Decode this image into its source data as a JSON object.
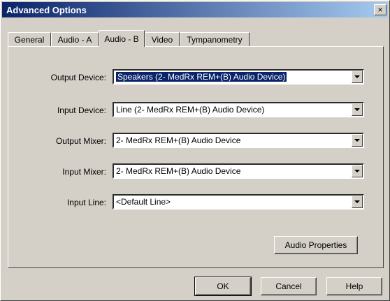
{
  "window": {
    "title": "Advanced Options",
    "close_label": "×"
  },
  "tabs": [
    {
      "label": "General"
    },
    {
      "label": "Audio - A"
    },
    {
      "label": "Audio - B"
    },
    {
      "label": "Video"
    },
    {
      "label": "Tympanometry"
    }
  ],
  "active_tab": "Audio - B",
  "fields": [
    {
      "label": "Output Device:",
      "value": "Speakers (2- MedRx REM+(B) Audio Device)"
    },
    {
      "label": "Input Device:",
      "value": "Line (2- MedRx REM+(B) Audio Device)"
    },
    {
      "label": "Output Mixer:",
      "value": "2- MedRx REM+(B) Audio Device"
    },
    {
      "label": "Input Mixer:",
      "value": "2- MedRx REM+(B) Audio Device"
    },
    {
      "label": "Input Line:",
      "value": "<Default Line>"
    }
  ],
  "buttons": {
    "audio_properties": "Audio Properties",
    "ok": "OK",
    "cancel": "Cancel",
    "help": "Help"
  },
  "colors": {
    "titlebar_start": "#0a246a",
    "titlebar_end": "#a6caf0",
    "face": "#d4d0c8",
    "highlight": "#0a246a"
  }
}
